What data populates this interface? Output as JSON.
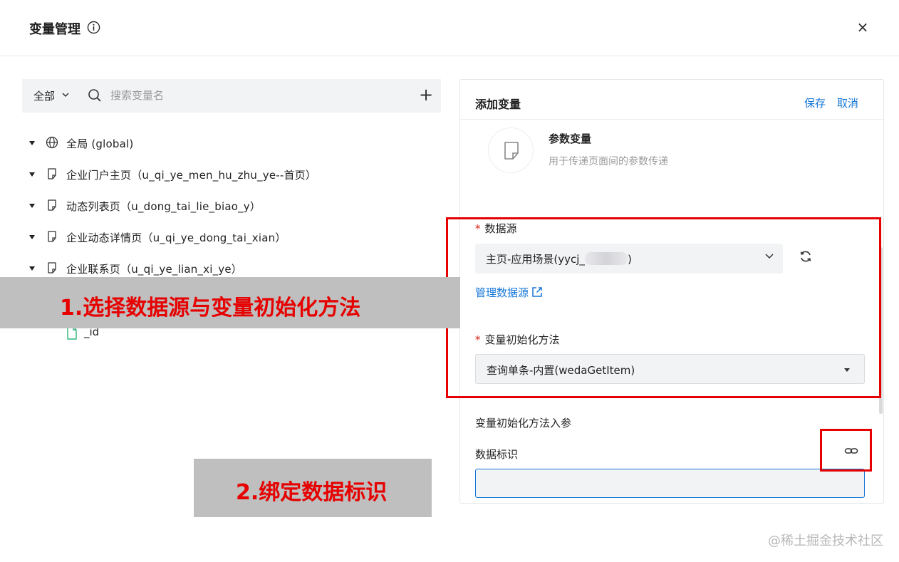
{
  "header": {
    "title": "变量管理",
    "info_icon": "info-icon",
    "close_label": "×"
  },
  "search": {
    "scope_label": "全部",
    "placeholder": "搜索变量名",
    "add_label": "+"
  },
  "tree": {
    "items": [
      {
        "label": "全局 (global)",
        "icon": "globe-icon"
      },
      {
        "label": "企业门户主页（u_qi_ye_men_hu_zhu_ye--首页）",
        "icon": "page-icon"
      },
      {
        "label": "动态列表页（u_dong_tai_lie_biao_y）",
        "icon": "page-icon"
      },
      {
        "label": "企业动态详情页（u_qi_ye_dong_tai_xian）",
        "icon": "page-icon"
      },
      {
        "label": "企业联系页（u_qi_ye_lian_xi_ye）",
        "icon": "page-icon"
      }
    ],
    "leaf": {
      "label": "_id",
      "icon": "file-icon"
    }
  },
  "panel": {
    "title": "添加变量",
    "save_label": "保存",
    "cancel_label": "取消",
    "variable_type": {
      "name": "参数变量",
      "description": "用于传递页面间的参数传递",
      "icon": "note-icon"
    },
    "data_source": {
      "label": "数据源",
      "value": "主页-应用场景(yycj_",
      "value_suffix": ")",
      "manage_link": "管理数据源"
    },
    "init_method": {
      "label": "变量初始化方法",
      "value": "查询单条-内置(wedaGetItem)"
    },
    "params_section_label": "变量初始化方法入参",
    "data_id": {
      "label": "数据标识",
      "value": ""
    }
  },
  "annotations": {
    "step1": "1.选择数据源与变量初始化方法",
    "step2": "2.绑定数据标识",
    "highlight_color": "#e60000",
    "banner_color": "#bfbfbf"
  },
  "watermark": "@稀土掘金技术社区",
  "colors": {
    "link": "#1677d8",
    "required": "#e2231a",
    "input_bg": "#f2f3f5"
  }
}
